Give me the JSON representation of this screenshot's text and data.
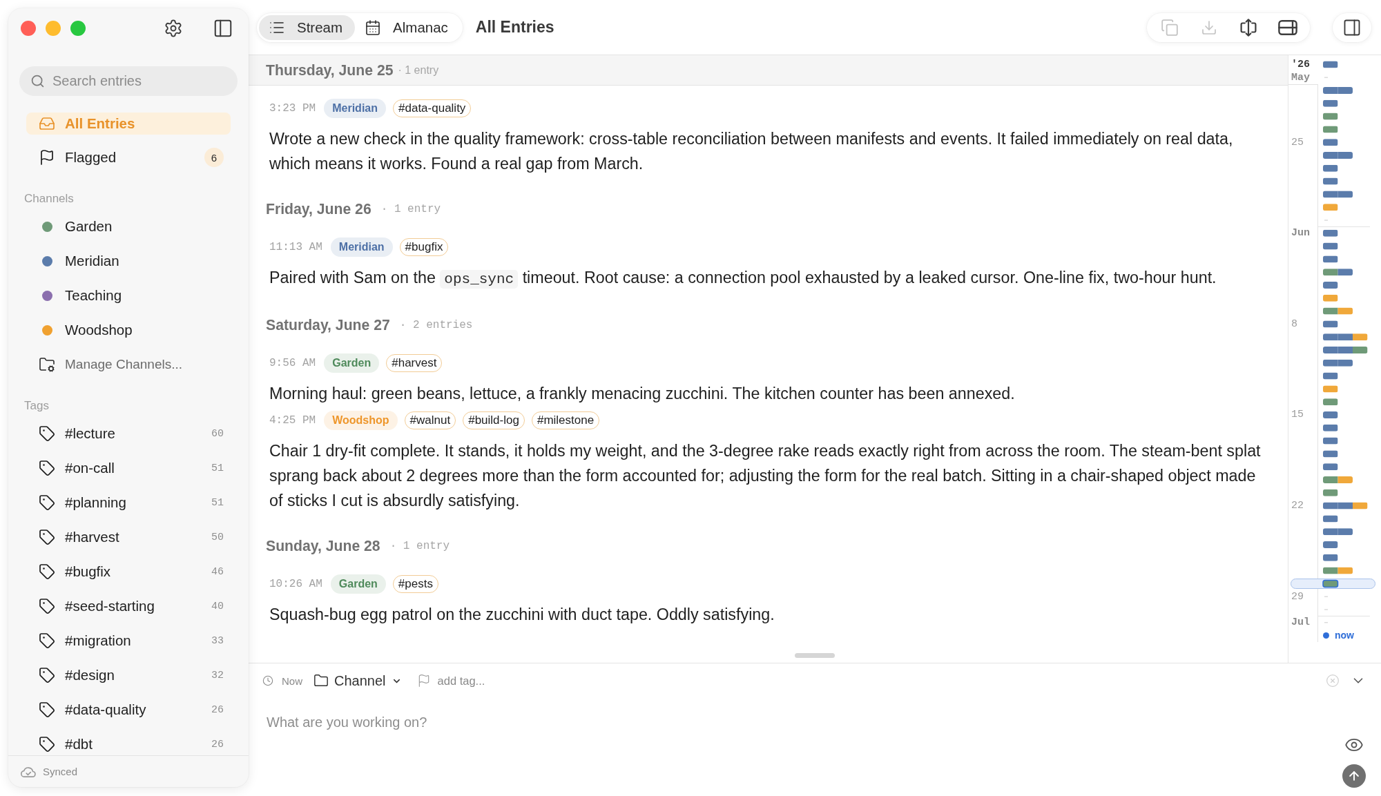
{
  "sidebar": {
    "search": {
      "placeholder": "Search entries"
    },
    "nav": [
      {
        "kind": "all",
        "label": "All Entries",
        "selected": true
      },
      {
        "kind": "flagged",
        "label": "Flagged",
        "selected": false,
        "badge": "6"
      }
    ],
    "channels": {
      "heading": "Channels",
      "items": [
        {
          "name": "Garden",
          "color": "#6f9a78"
        },
        {
          "name": "Meridian",
          "color": "#5b7cab"
        },
        {
          "name": "Teaching",
          "color": "#8b6fae"
        },
        {
          "name": "Woodshop",
          "color": "#f0a130"
        }
      ],
      "manage": "Manage Channels..."
    },
    "tags": {
      "heading": "Tags",
      "items": [
        {
          "label": "#lecture",
          "count": "60"
        },
        {
          "label": "#on-call",
          "count": "51"
        },
        {
          "label": "#planning",
          "count": "51"
        },
        {
          "label": "#harvest",
          "count": "50"
        },
        {
          "label": "#bugfix",
          "count": "46"
        },
        {
          "label": "#seed-starting",
          "count": "40"
        },
        {
          "label": "#migration",
          "count": "33"
        },
        {
          "label": "#design",
          "count": "32"
        },
        {
          "label": "#data-quality",
          "count": "26"
        },
        {
          "label": "#dbt",
          "count": "26"
        }
      ]
    },
    "sync_status": "Synced"
  },
  "toolbar": {
    "views": [
      {
        "kind": "list",
        "label": "Stream",
        "selected": true
      },
      {
        "kind": "calendar",
        "label": "Almanac",
        "selected": false
      }
    ],
    "title": "All Entries",
    "actions": [
      {
        "kind": "copy",
        "disabled": true
      },
      {
        "kind": "download",
        "disabled": true
      },
      {
        "kind": "expand",
        "disabled": false
      },
      {
        "kind": "layout",
        "disabled": false
      }
    ]
  },
  "stream": {
    "days": [
      {
        "date": "Thursday, June 25",
        "count": "· 1 entry",
        "sticky": true,
        "entries": [
          {
            "time": "3:23 PM",
            "channel": {
              "name": "Meridian",
              "color": "#4d70a6"
            },
            "tags": [
              "#data-quality"
            ],
            "body": [
              {
                "kind": "text",
                "text": "Wrote a new check in the quality framework: cross-table reconciliation between manifests and events. It failed immediately on real data, which means it works. Found a real gap from March."
              }
            ]
          }
        ]
      },
      {
        "date": "Friday, June 26",
        "count": "· 1 entry",
        "sticky": false,
        "entries": [
          {
            "time": "11:13 AM",
            "channel": {
              "name": "Meridian",
              "color": "#4d70a6"
            },
            "tags": [
              "#bugfix"
            ],
            "body": [
              {
                "kind": "text",
                "text": "Paired with Sam on the "
              },
              {
                "kind": "code",
                "text": "ops_sync"
              },
              {
                "kind": "text",
                "text": " timeout. Root cause: a connection pool exhausted by a leaked cursor. One-line fix, two-hour hunt."
              }
            ]
          }
        ]
      },
      {
        "date": "Saturday, June 27",
        "count": "· 2 entries",
        "sticky": false,
        "entries": [
          {
            "time": "9:56 AM",
            "channel": {
              "name": "Garden",
              "color": "#4f8a5b"
            },
            "tags": [
              "#harvest"
            ],
            "body": [
              {
                "kind": "text",
                "text": "Morning haul: green beans, lettuce, a frankly menacing zucchini. The kitchen counter has been annexed."
              }
            ]
          },
          {
            "time": "4:25 PM",
            "channel": {
              "name": "Woodshop",
              "color": "#ee962a"
            },
            "tags": [
              "#walnut",
              "#build-log",
              "#milestone"
            ],
            "body": [
              {
                "kind": "text",
                "text": "Chair 1 dry-fit complete. It stands, it holds my weight, and the 3-degree rake reads exactly right from across the room. The steam-bent splat sprang back about 2 degrees more than the form accounted for; adjusting the form for the real batch. Sitting in a chair-shaped object made of sticks I cut is absurdly satisfying."
              }
            ]
          }
        ]
      },
      {
        "date": "Sunday, June 28",
        "count": "· 1 entry",
        "sticky": false,
        "entries": [
          {
            "time": "10:26 AM",
            "channel": {
              "name": "Garden",
              "color": "#4f8a5b"
            },
            "tags": [
              "#pests"
            ],
            "body": [
              {
                "kind": "text",
                "text": "Squash-bug egg patrol on the zucchini with duct tape. Oddly satisfying."
              }
            ]
          }
        ]
      }
    ]
  },
  "timeline": {
    "labels": [
      {
        "kind": "year",
        "text": "'26"
      },
      {
        "kind": "month",
        "text": "May"
      },
      {
        "kind": "day",
        "text": "25"
      },
      {
        "kind": "month",
        "text": "Jun"
      },
      {
        "kind": "day",
        "text": "8"
      },
      {
        "kind": "day",
        "text": "15"
      },
      {
        "kind": "day",
        "text": "22"
      },
      {
        "kind": "day",
        "text": "29"
      },
      {
        "kind": "month",
        "text": "Jul"
      }
    ],
    "now": "now"
  },
  "composer": {
    "time": "Now",
    "channel": "Channel",
    "tag_placeholder": "add tag...",
    "placeholder": "What are you working on?"
  }
}
